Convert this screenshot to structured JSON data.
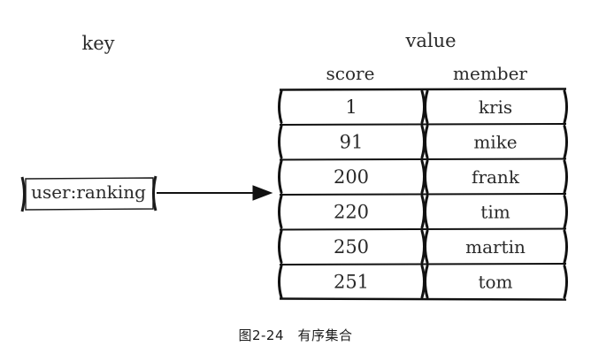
{
  "labels": {
    "key_heading": "key",
    "value_heading": "value",
    "score_heading": "score",
    "member_heading": "member"
  },
  "key_name": "user:ranking",
  "rows": [
    {
      "score": "1",
      "member": "kris"
    },
    {
      "score": "91",
      "member": "mike"
    },
    {
      "score": "200",
      "member": "frank"
    },
    {
      "score": "220",
      "member": "tim"
    },
    {
      "score": "250",
      "member": "martin"
    },
    {
      "score": "251",
      "member": "tom"
    }
  ],
  "caption": "图2-24　有序集合"
}
